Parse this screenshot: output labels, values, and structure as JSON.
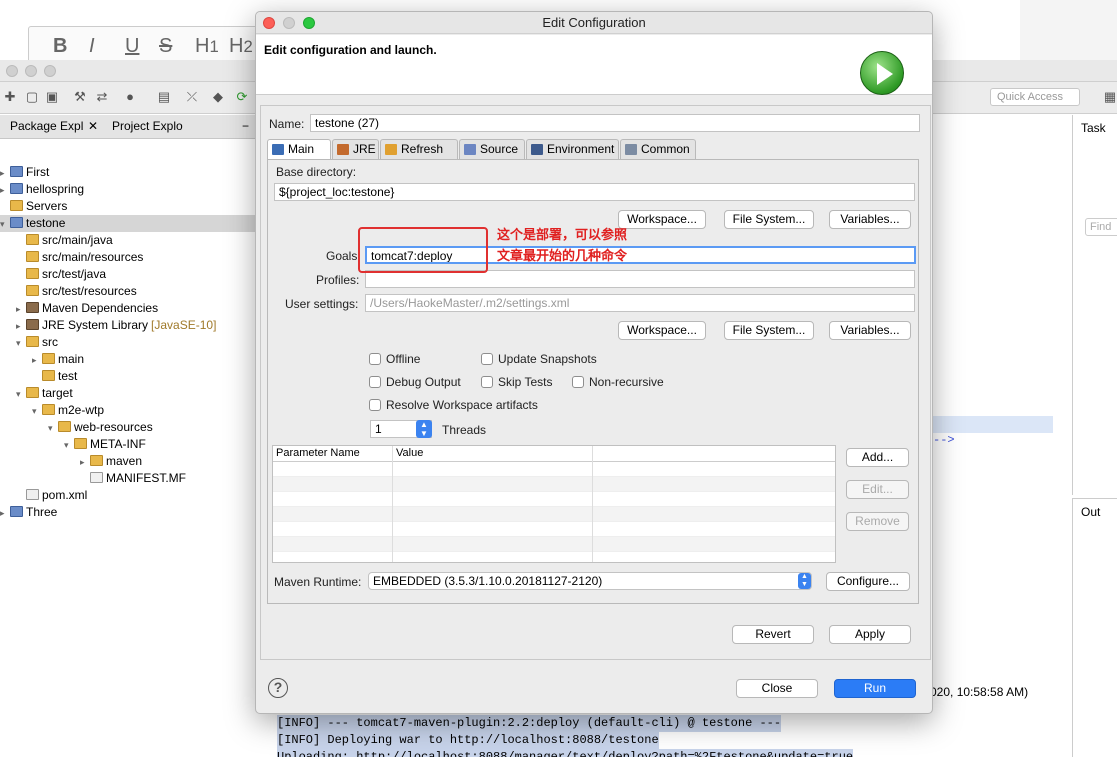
{
  "background": {
    "quick_access": "Quick Access",
    "pkg_tab_1": "Package Expl",
    "pkg_tab_2": "Project Explo",
    "tasks_tab": "Task",
    "find_placeholder": "Find",
    "outline_tab": "Out",
    "console_timestamp": "020, 10:58:58 AM)",
    "console_lines": [
      "[INFO] --- tomcat7-maven-plugin:2.2:deploy (default-cli) @ testone ---",
      "[INFO] Deploying war to http://localhost:8088/testone",
      "Uploading: http://localhost:8088/manager/text/deploy?path=%2Ftestone&update=true"
    ],
    "editor_arrow": "-->"
  },
  "tree": [
    {
      "label": "First",
      "indent": 0,
      "icon": "proj",
      "arrow": "▸"
    },
    {
      "label": "hellospring",
      "indent": 0,
      "icon": "proj",
      "arrow": "▸"
    },
    {
      "label": "Servers",
      "indent": 0,
      "icon": "folder",
      "arrow": ""
    },
    {
      "label": "testone",
      "indent": 0,
      "icon": "proj",
      "arrow": "▾"
    },
    {
      "label": "src/main/java",
      "indent": 1,
      "icon": "folder",
      "arrow": ""
    },
    {
      "label": "src/main/resources",
      "indent": 1,
      "icon": "folder",
      "arrow": ""
    },
    {
      "label": "src/test/java",
      "indent": 1,
      "icon": "folder",
      "arrow": ""
    },
    {
      "label": "src/test/resources",
      "indent": 1,
      "icon": "folder",
      "arrow": ""
    },
    {
      "label": "Maven Dependencies",
      "indent": 1,
      "icon": "jar",
      "arrow": "▸"
    },
    {
      "label": "JRE System Library",
      "suffix": "[JavaSE-10]",
      "indent": 1,
      "icon": "jar",
      "arrow": "▸"
    },
    {
      "label": "src",
      "indent": 1,
      "icon": "folder",
      "arrow": "▾"
    },
    {
      "label": "main",
      "indent": 2,
      "icon": "folder",
      "arrow": "▸"
    },
    {
      "label": "test",
      "indent": 2,
      "icon": "folder",
      "arrow": ""
    },
    {
      "label": "target",
      "indent": 1,
      "icon": "folder",
      "arrow": "▾"
    },
    {
      "label": "m2e-wtp",
      "indent": 2,
      "icon": "folder",
      "arrow": "▾"
    },
    {
      "label": "web-resources",
      "indent": 3,
      "icon": "folder",
      "arrow": "▾"
    },
    {
      "label": "META-INF",
      "indent": 4,
      "icon": "folder",
      "arrow": "▾"
    },
    {
      "label": "maven",
      "indent": 5,
      "icon": "folder",
      "arrow": "▸"
    },
    {
      "label": "MANIFEST.MF",
      "indent": 5,
      "icon": "file",
      "arrow": ""
    },
    {
      "label": "pom.xml",
      "indent": 1,
      "icon": "file",
      "arrow": ""
    },
    {
      "label": "Three",
      "indent": 0,
      "icon": "proj",
      "arrow": "▸"
    }
  ],
  "dialog": {
    "title": "Edit Configuration",
    "heading": "Edit configuration and launch.",
    "name_label": "Name:",
    "name_value": "testone (27)",
    "tabs": [
      "Main",
      "JRE",
      "Refresh",
      "Source",
      "Environment",
      "Common"
    ],
    "base_dir_label": "Base directory:",
    "base_dir_value": "${project_loc:testone}",
    "workspace": "Workspace...",
    "file_system": "File System...",
    "variables": "Variables...",
    "goals_label": "Goals:",
    "goals_value": "tomcat7:deploy",
    "profiles_label": "Profiles:",
    "profiles_value": "",
    "user_settings_label": "User settings:",
    "user_settings_value": "/Users/HaokeMaster/.m2/settings.xml",
    "annotation_line1": "这个是部署，可以参照",
    "annotation_line2": "文章最开始的几种命令",
    "offline": "Offline",
    "update_snapshots": "Update Snapshots",
    "debug_output": "Debug Output",
    "skip_tests": "Skip Tests",
    "non_recursive": "Non-recursive",
    "resolve_workspace": "Resolve Workspace artifacts",
    "threads_value": "1",
    "threads_label": "Threads",
    "param_name_col": "Parameter Name",
    "param_value_col": "Value",
    "add": "Add...",
    "edit": "Edit...",
    "remove": "Remove",
    "maven_runtime_label": "Maven Runtime:",
    "maven_runtime_value": "EMBEDDED (3.5.3/1.10.0.20181127-2120)",
    "configure": "Configure...",
    "revert": "Revert",
    "apply": "Apply",
    "close": "Close",
    "run": "Run",
    "help": "?"
  },
  "colors": {
    "accent": "#2b7cf6",
    "annotation": "#e02020"
  }
}
